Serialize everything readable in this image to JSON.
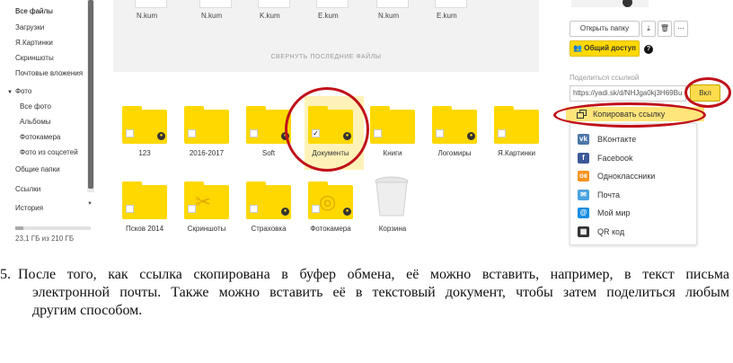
{
  "sidebar": {
    "items": [
      {
        "label": "Все файлы",
        "level": "l1",
        "active": true
      },
      {
        "label": "Загрузки",
        "level": "l1"
      },
      {
        "label": "Я.Картинки",
        "level": "l1"
      },
      {
        "label": "Скриншоты",
        "level": "l1"
      },
      {
        "label": "Почтовые вложения",
        "level": "l1"
      },
      {
        "label": "Фото",
        "level": "hdr"
      },
      {
        "label": "Все фото",
        "level": "l2"
      },
      {
        "label": "Альбомы",
        "level": "l2"
      },
      {
        "label": "Фотокамера",
        "level": "l2"
      },
      {
        "label": "Фото из соцсетей",
        "level": "l2"
      },
      {
        "label": "Общие папки",
        "level": "l1"
      },
      {
        "label": "Ссылки",
        "level": "l1"
      },
      {
        "label": "История",
        "level": "l1"
      }
    ],
    "quota_text": "23,1 ГБ из 210 ГБ",
    "quota_used": 0.11
  },
  "recent": {
    "files": [
      "N.kum",
      "N.kum",
      "K.kum",
      "E.kum",
      "N.kum",
      "E.kum"
    ],
    "collapse_label": "СВЕРНУТЬ ПОСЛЕДНИЕ ФАЙЛЫ"
  },
  "folders": [
    {
      "name": "123",
      "shared": true
    },
    {
      "name": "2016-2017",
      "shared": false
    },
    {
      "name": "Soft",
      "shared": true
    },
    {
      "name": "Документы",
      "shared": true,
      "selected": true
    },
    {
      "name": "Книги",
      "shared": false
    },
    {
      "name": "Логомиры",
      "shared": true
    },
    {
      "name": "Я.Картинки",
      "shared": false
    },
    {
      "name": "Псков 2014",
      "shared": false
    },
    {
      "name": "Скриншоты",
      "shared": false,
      "icon": "scissors-icon"
    },
    {
      "name": "Страховка",
      "shared": true
    },
    {
      "name": "Фотокамера",
      "shared": true,
      "icon": "camera-icon"
    },
    {
      "name": "Корзина",
      "type": "trash"
    }
  ],
  "panel": {
    "open_folder_label": "Открыть папку",
    "shared_access_label": "Общий доступ",
    "help_glyph": "?",
    "share_link_caption": "Поделиться ссылкой",
    "link_value": "https://yadi.sk/d/NHJga0kj3H69Bu",
    "toggle_label": "Вкл",
    "copy_link_label": "Копировать ссылку",
    "share_targets": [
      {
        "label": "ВКонтакте",
        "icon": "vk-icon",
        "color": "#4a76a8",
        "glyph": "vk"
      },
      {
        "label": "Facebook",
        "icon": "facebook-icon",
        "color": "#3b5998",
        "glyph": "f"
      },
      {
        "label": "Одноклассники",
        "icon": "odnoklassniki-icon",
        "color": "#f7931e",
        "glyph": "ок"
      },
      {
        "label": "Почта",
        "icon": "mail-icon",
        "color": "#4aa3df",
        "glyph": "✉"
      },
      {
        "label": "Мой мир",
        "icon": "moi-mir-icon",
        "color": "#168de2",
        "glyph": "@"
      },
      {
        "label": "QR код",
        "icon": "qr-code-icon",
        "color": "#333333",
        "glyph": "▦"
      }
    ]
  },
  "annotation_color": "#c0101a",
  "caption": {
    "number": "5.",
    "line1": "После того, как ссылка скопирована в буфер обмена, её можно вставить, например, в текст письма",
    "line2": "электронной почты. Также можно вставить её в текстовый документ, чтобы затем поделиться любым",
    "line3": "другим способом."
  }
}
